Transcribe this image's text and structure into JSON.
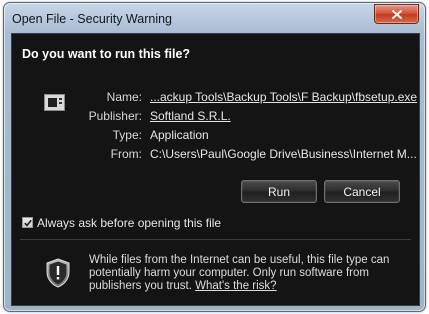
{
  "window": {
    "title": "Open File - Security Warning"
  },
  "dialog": {
    "heading": "Do you want to run this file?",
    "fields": [
      {
        "label": "Name:",
        "value": "...ackup Tools\\Backup Tools\\F Backup\\fbsetup.exe",
        "is_link": true
      },
      {
        "label": "Publisher:",
        "value": "Softland S.R.L.",
        "is_link": true
      },
      {
        "label": "Type:",
        "value": "Application",
        "is_link": false
      },
      {
        "label": "From:",
        "value": "C:\\Users\\Paul\\Google Drive\\Business\\Internet M...",
        "is_link": false
      }
    ],
    "run_label": "Run",
    "cancel_label": "Cancel",
    "always_ask_label": "Always ask before opening this file",
    "always_ask_checked": true,
    "warning_text": "While files from the Internet can be useful, this file type can potentially harm your computer. Only run software from publishers you trust.",
    "warning_link": "What's the risk?"
  },
  "icons": {
    "close": "close-icon",
    "file": "application-file-icon",
    "shield": "security-shield-icon",
    "check": "checkmark-icon"
  },
  "colors": {
    "client_bg": "#141414",
    "frame": "#b8cade",
    "close_red": "#d24f34"
  }
}
